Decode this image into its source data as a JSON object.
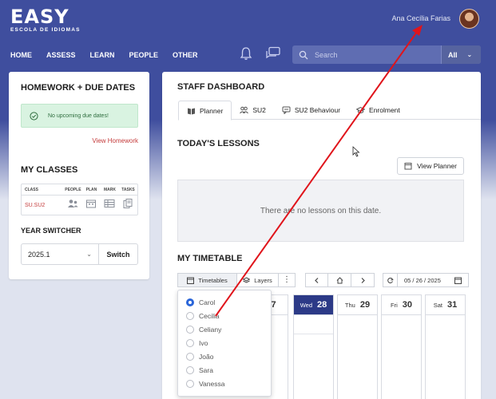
{
  "app": {
    "logo": "EASY",
    "logo_sub": "ESCOLA DE IDIOMAS",
    "user_name": "Ana Cecília Farias"
  },
  "nav": {
    "items": [
      {
        "label": "HOME"
      },
      {
        "label": "ASSESS"
      },
      {
        "label": "LEARN"
      },
      {
        "label": "PEOPLE"
      },
      {
        "label": "OTHER"
      }
    ]
  },
  "search": {
    "placeholder": "Search",
    "scope": "All"
  },
  "homework": {
    "title": "HOMEWORK + DUE DATES",
    "empty_message": "No upcoming due dates!",
    "view_link": "View Homework"
  },
  "classes": {
    "title": "MY CLASSES",
    "columns": [
      "CLASS",
      "PEOPLE",
      "PLAN",
      "MARK",
      "TASKS"
    ],
    "rows": [
      {
        "name": "SU.SU2"
      }
    ]
  },
  "year_switcher": {
    "title": "YEAR SWITCHER",
    "value": "2025.1",
    "button": "Switch"
  },
  "dashboard": {
    "title": "STAFF DASHBOARD",
    "tabs": [
      {
        "label": "Planner",
        "icon": "book-icon"
      },
      {
        "label": "SU2",
        "icon": "group-icon"
      },
      {
        "label": "SU2 Behaviour",
        "icon": "comment-icon"
      },
      {
        "label": "Enrolment",
        "icon": "graduation-cap-icon"
      }
    ]
  },
  "lessons": {
    "title": "TODAY'S LESSONS",
    "view_planner": "View Planner",
    "empty": "There are no lessons on this date."
  },
  "timetable": {
    "title": "MY TIMETABLE",
    "timetables_btn": "Timetables",
    "layers_btn": "Layers",
    "date": "05 / 26 / 2025",
    "days": [
      {
        "name": "",
        "date": "27"
      },
      {
        "name": "Wed",
        "date": "28",
        "selected": true
      },
      {
        "name": "Thu",
        "date": "29"
      },
      {
        "name": "Fri",
        "date": "30"
      },
      {
        "name": "Sat",
        "date": "31"
      }
    ],
    "teachers": [
      {
        "name": "Carol",
        "selected": true
      },
      {
        "name": "Cecilia"
      },
      {
        "name": "Celiany"
      },
      {
        "name": "Ivo"
      },
      {
        "name": "João"
      },
      {
        "name": "Sara"
      },
      {
        "name": "Vanessa"
      }
    ]
  },
  "colors": {
    "header": "#3f4e9e",
    "accent_red": "#c43b3b",
    "selected_day": "#2c3a87",
    "annotation_arrow": "#e0141b"
  }
}
